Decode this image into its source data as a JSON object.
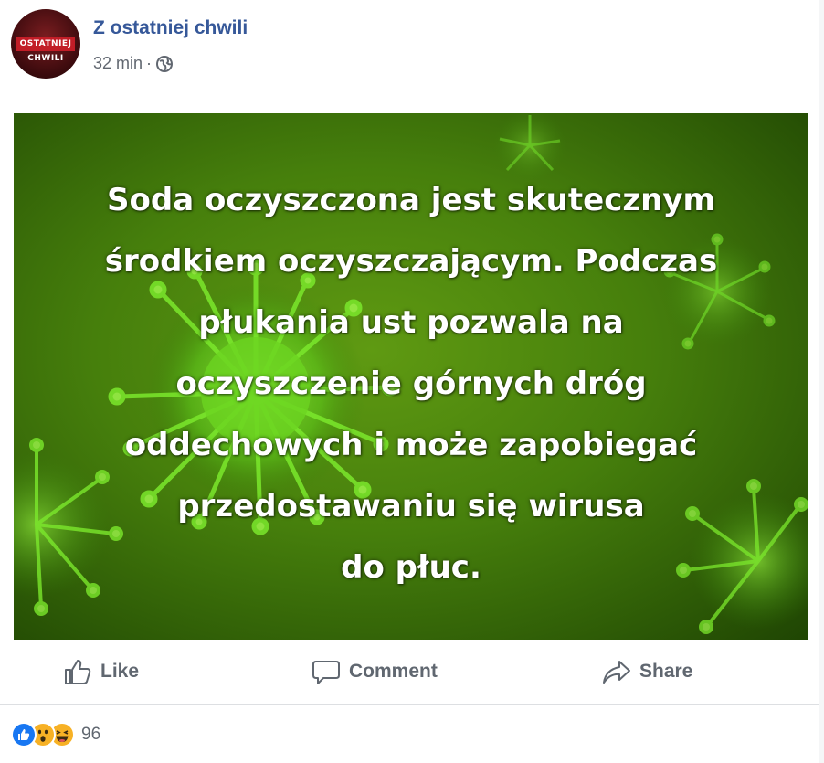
{
  "post": {
    "page_name": "Z ostatniej chwili",
    "time": "32 min",
    "separator": "·",
    "privacy_icon": "globe-icon",
    "avatar_text": "OSTATNIEJ CHWILI",
    "image_text": "Soda oczyszczona jest skutecznym\nśrodkiem oczyszczającym. Podczas\npłukania ust pozwala na\noczyszczenie górnych dróg\noddechowych i może zapobiegać\nprzedostawaniu się wirusa\ndo płuc.",
    "image_bg_color": "#4a820c"
  },
  "actions": {
    "like": "Like",
    "comment": "Comment",
    "share": "Share"
  },
  "reactions": {
    "icons": [
      "like-reaction-icon",
      "wow-reaction-icon",
      "haha-reaction-icon"
    ],
    "count": "96"
  },
  "colors": {
    "link": "#365899",
    "muted": "#606770",
    "like_blue": "#1877f2",
    "emoji_yellow": "#f7b125"
  }
}
